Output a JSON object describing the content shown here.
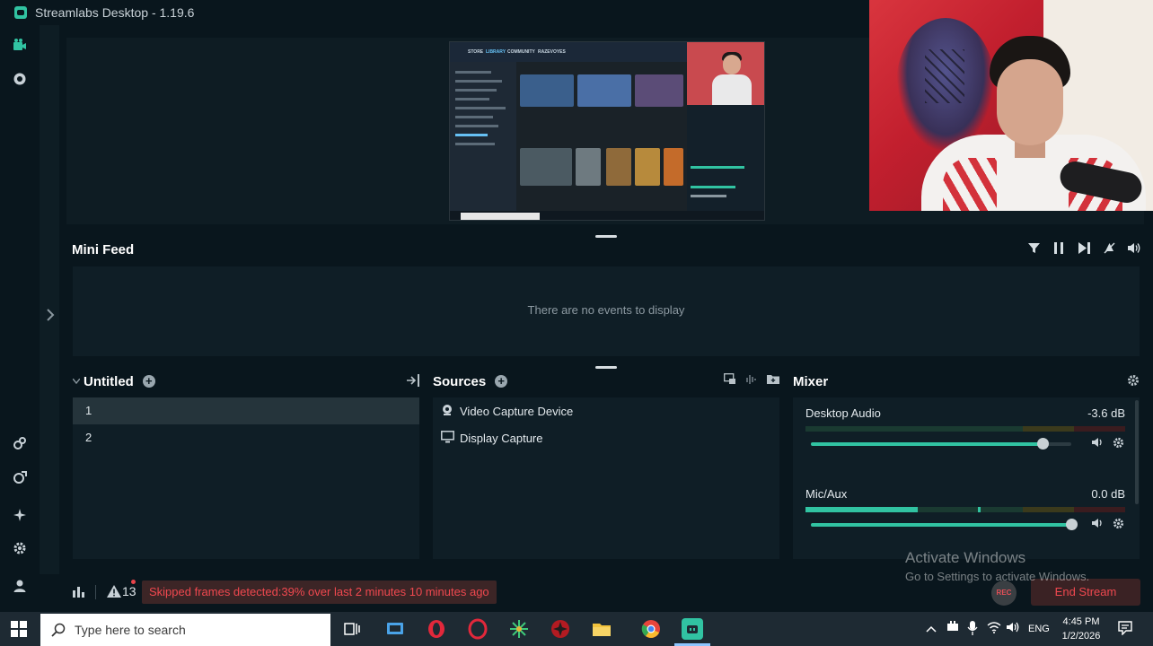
{
  "window": {
    "title": "Streamlabs Desktop - 1.19.6"
  },
  "leftrail": {
    "top": [
      {
        "icon": "editor-icon"
      },
      {
        "icon": "record-icon"
      }
    ],
    "bottom": [
      {
        "icon": "link-icon"
      },
      {
        "icon": "integrations-icon"
      },
      {
        "icon": "sparkle-icon"
      },
      {
        "icon": "gear-icon"
      },
      {
        "icon": "user-icon"
      }
    ]
  },
  "preview_screen": {
    "nav": [
      "STORE",
      "LIBRARY",
      "COMMUNITY",
      "RAZEVOYES"
    ]
  },
  "minifeed": {
    "title": "Mini Feed",
    "empty_text": "There are no events to display",
    "tools": [
      "filter-icon",
      "pause-icon",
      "skip-icon",
      "mute-alerts-icon",
      "volume-icon"
    ]
  },
  "scenes": {
    "title": "Untitled",
    "items": [
      "1",
      "2"
    ],
    "selected": "1"
  },
  "sources": {
    "title": "Sources",
    "items": [
      {
        "label": "Video Capture Device",
        "icon": "webcam-icon"
      },
      {
        "label": "Display Capture",
        "icon": "monitor-icon"
      }
    ]
  },
  "mixer": {
    "title": "Mixer",
    "channels": [
      {
        "name": "Desktop Audio",
        "db": "-3.6 dB",
        "level": 0.0,
        "volume": 0.89
      },
      {
        "name": "Mic/Aux",
        "db": "0.0 dB",
        "level": 0.35,
        "peak": 0.54,
        "volume": 1.0
      }
    ]
  },
  "footer": {
    "warning_count": "13",
    "alert": "Skipped frames detected:39% over last 2 minutes 10 minutes ago",
    "rec_label": "REC",
    "end_stream": "End Stream"
  },
  "watermark": {
    "line1": "Activate Windows",
    "line2": "Go to Settings to activate Windows."
  },
  "taskbar": {
    "search_placeholder": "Type here to search",
    "language": "ENG",
    "time": "4:45 PM",
    "date": "1/2/2026"
  },
  "colors": {
    "accent": "#31c3a2",
    "background": "#09161d",
    "panel": "#0f1e26",
    "danger": "#f0484f"
  }
}
